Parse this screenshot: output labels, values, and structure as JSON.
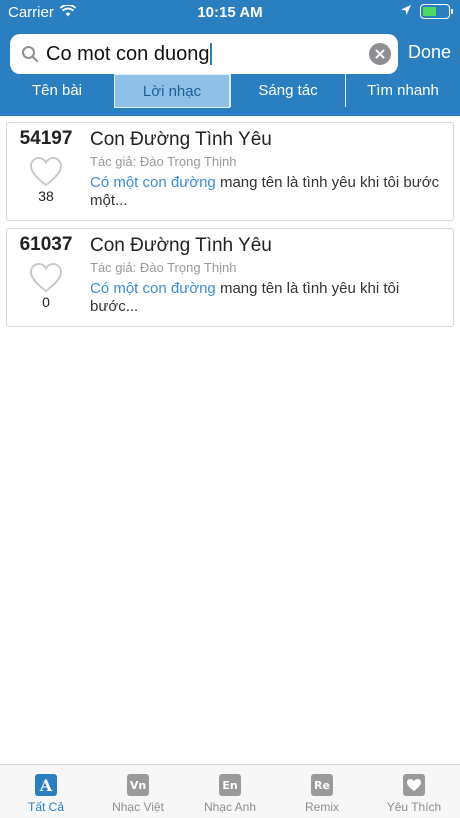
{
  "status": {
    "carrier": "Carrier",
    "time": "10:15 AM",
    "battery_level": 0.55
  },
  "search": {
    "query": "Co mot con duong",
    "done_label": "Done"
  },
  "segments": [
    {
      "label": "Tên bài",
      "active": false
    },
    {
      "label": "Lời nhạc",
      "active": true
    },
    {
      "label": "Sáng tác",
      "active": false
    },
    {
      "label": "Tìm nhanh",
      "active": false
    }
  ],
  "results": [
    {
      "id": "54197",
      "likes": "38",
      "title": "Con Đường Tình Yêu",
      "author": "Tác giả: Đào Trọng Thịnh",
      "highlight": "Có một con đường",
      "rest": " mang tên là tình yêu khi tôi bước một..."
    },
    {
      "id": "61037",
      "likes": "0",
      "title": "Con Đường Tình Yêu",
      "author": "Tác giả: Đào Trọng Thịnh",
      "highlight": "Có một con đường",
      "rest": " mang tên là tình yêu khi tôi bước..."
    }
  ],
  "tabs": [
    {
      "label": "Tất Cả",
      "icon": "A",
      "active": true
    },
    {
      "label": "Nhạc Việt",
      "icon": "Vn",
      "active": false
    },
    {
      "label": "Nhạc Anh",
      "icon": "En",
      "active": false
    },
    {
      "label": "Remix",
      "icon": "Re",
      "active": false
    },
    {
      "label": "Yêu Thích",
      "icon": "heart",
      "active": false
    }
  ],
  "colors": {
    "accent": "#2a7fc1",
    "highlight": "#3b8ed0",
    "battery": "#4cd964"
  }
}
